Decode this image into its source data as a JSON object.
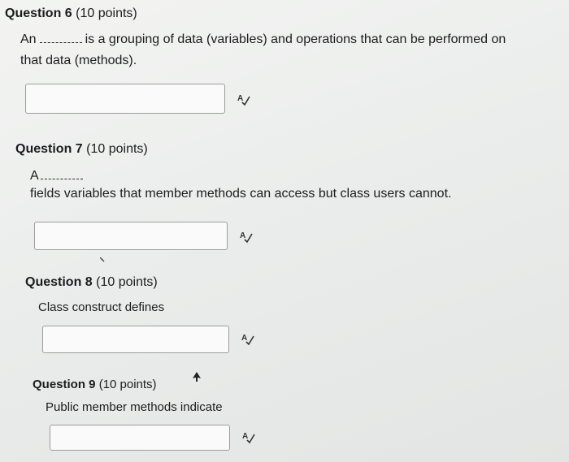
{
  "questions": [
    {
      "number_label": "Question 6",
      "points_label": "(10 points)",
      "text_before_blank": "An",
      "text_after_blank": "is a grouping of data (variables) and operations that can be performed on",
      "text_line2": "that data (methods).",
      "answer_value": ""
    },
    {
      "number_label": "Question 7",
      "points_label": "(10 points)",
      "text_before_blank": "A",
      "text_line2": "fields variables that member methods can access but class users cannot.",
      "answer_value": ""
    },
    {
      "number_label": "Question 8",
      "points_label": "(10 points)",
      "text": "Class construct defines",
      "answer_value": ""
    },
    {
      "number_label": "Question 9",
      "points_label": "(10 points)",
      "text": "Public member methods indicate",
      "answer_value": ""
    }
  ],
  "icons": {
    "spellcheck": "spellcheck-icon",
    "cursor": "mouse-cursor-icon"
  }
}
